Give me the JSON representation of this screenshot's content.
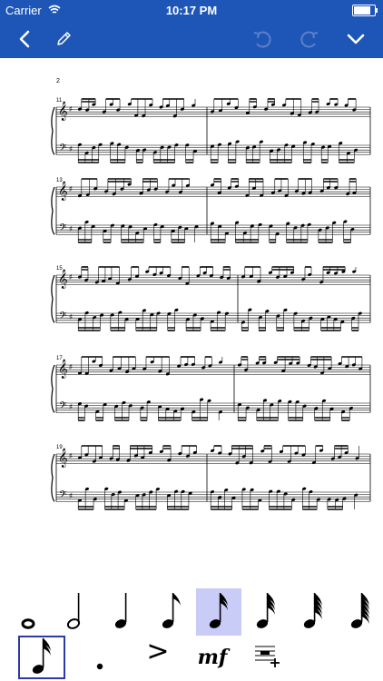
{
  "status_bar": {
    "carrier": "Carrier",
    "time": "10:17 PM"
  },
  "navbar": {
    "back_icon": "chevron-left-icon",
    "edit_icon": "pencil-icon",
    "undo_icon": "undo-icon",
    "redo_icon": "redo-icon",
    "collapse_icon": "chevron-down-icon"
  },
  "score": {
    "page_number": "2",
    "systems": [
      {
        "measure": "11"
      },
      {
        "measure": "13"
      },
      {
        "measure": "15"
      },
      {
        "measure": "17"
      },
      {
        "measure": "19"
      }
    ]
  },
  "palette": {
    "row1": [
      "whole-note",
      "half-note",
      "quarter-note",
      "eighth-note",
      "sixteenth-note",
      "thirty-second-note",
      "sixty-fourth-note",
      "one-twenty-eighth-note"
    ],
    "selected_duration": "sixteenth-note",
    "row2": [
      "sixteenth-note",
      "dot",
      "accent",
      "mf",
      "insert-rest"
    ],
    "dynamic_label": "mf",
    "accent_label": ">"
  }
}
